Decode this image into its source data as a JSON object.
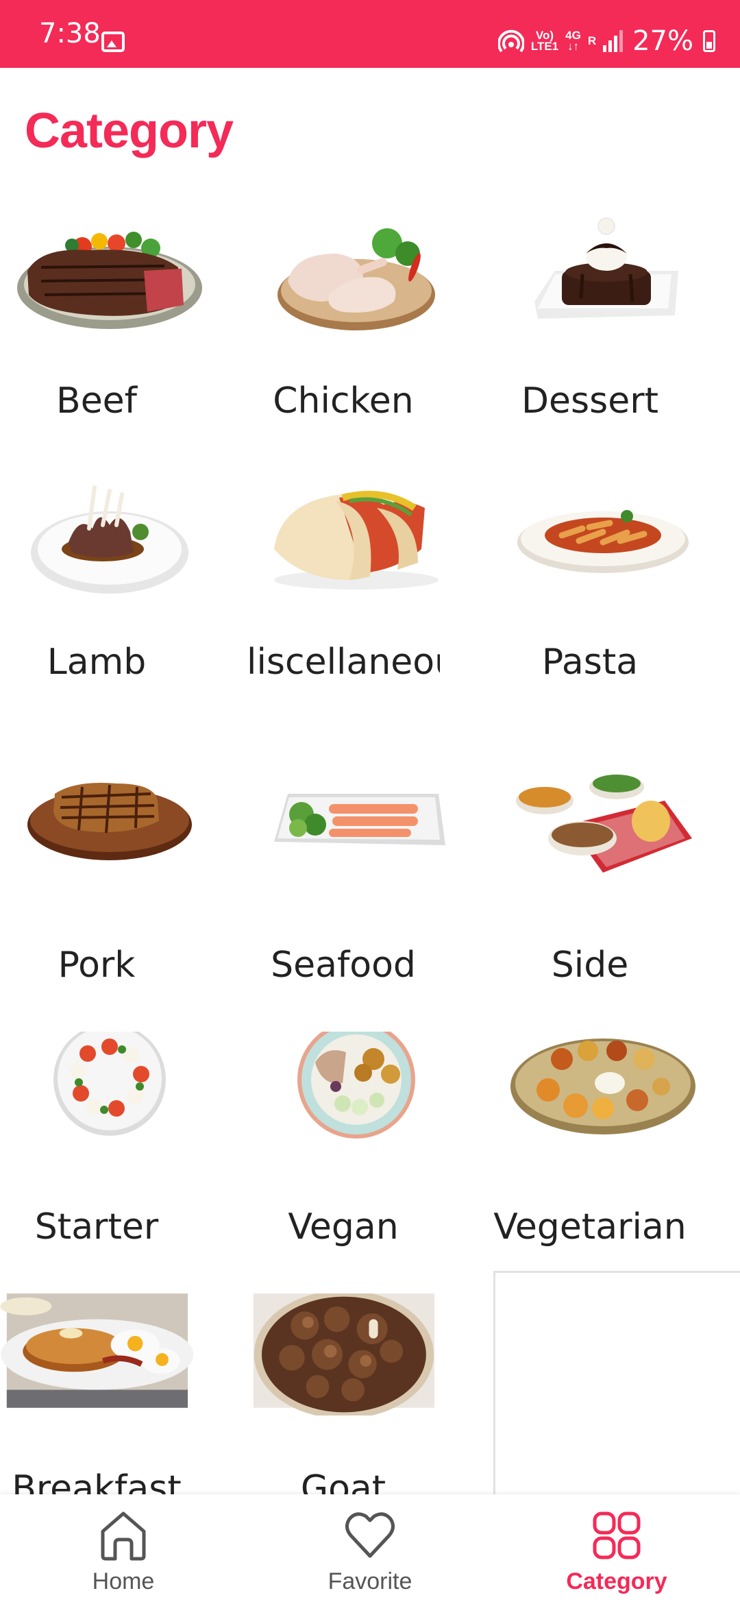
{
  "status_bar": {
    "time": "7:38",
    "signal_top": "Vo)",
    "signal_bottom": "LTE1",
    "network": "4G",
    "roaming": "R",
    "battery": "27%"
  },
  "page_title": "Category",
  "categories": [
    {
      "name": "Beef",
      "icon": "steak-plate"
    },
    {
      "name": "Chicken",
      "icon": "chicken-legs-board"
    },
    {
      "name": "Dessert",
      "icon": "chocolate-cake-plate"
    },
    {
      "name": "Lamb",
      "icon": "lamb-chops-plate"
    },
    {
      "name": "liscellaneou",
      "icon": "tacos"
    },
    {
      "name": "Pasta",
      "icon": "penne-bowl"
    },
    {
      "name": "Pork",
      "icon": "pork-chop-board"
    },
    {
      "name": "Seafood",
      "icon": "salmon-platter"
    },
    {
      "name": "Side",
      "icon": "side-bowls"
    },
    {
      "name": "Starter",
      "icon": "caprese-plate"
    },
    {
      "name": "Vegan",
      "icon": "vegan-bowl"
    },
    {
      "name": "Vegetarian",
      "icon": "thali-plate"
    },
    {
      "name": "Breakfast",
      "icon": "pancakes-eggs-photo"
    },
    {
      "name": "Goat",
      "icon": "goat-curry-photo"
    }
  ],
  "bottom_nav": [
    {
      "label": "Home",
      "icon": "home-icon",
      "active": false
    },
    {
      "label": "Favorite",
      "icon": "heart-icon",
      "active": false
    },
    {
      "label": "Category",
      "icon": "grid-icon",
      "active": true
    }
  ],
  "colors": {
    "accent": "#F42A57",
    "text": "#222222",
    "nav_inactive": "#555555"
  }
}
